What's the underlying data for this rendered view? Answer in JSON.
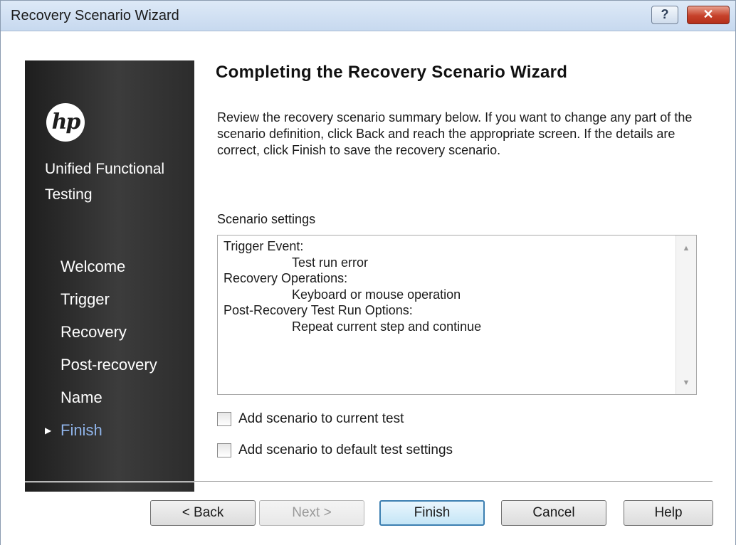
{
  "window": {
    "title": "Recovery Scenario Wizard",
    "help_button": "?",
    "close_button": "✕"
  },
  "sidebar": {
    "logo_text": "hp",
    "product_name": "Unified Functional Testing",
    "steps": [
      {
        "label": "Welcome",
        "active": false
      },
      {
        "label": "Trigger",
        "active": false
      },
      {
        "label": "Recovery",
        "active": false
      },
      {
        "label": "Post-recovery",
        "active": false
      },
      {
        "label": "Name",
        "active": false
      },
      {
        "label": "Finish",
        "active": true
      }
    ],
    "active_arrow": "▶"
  },
  "main": {
    "heading": "Completing the Recovery Scenario Wizard",
    "description": "Review the recovery scenario summary below. If you want to change any part of the scenario definition, click Back and reach the appropriate screen. If the details are correct, click Finish to save the recovery scenario.",
    "settings_label": "Scenario settings",
    "summary": {
      "trigger_title": "Trigger Event:",
      "trigger_value": "Test run error",
      "recovery_title": "Recovery Operations:",
      "recovery_value": "Keyboard or mouse operation",
      "post_title": "Post-Recovery Test Run Options:",
      "post_value": "Repeat current step and continue"
    },
    "checkbox_current_test": {
      "label": "Add scenario to current test",
      "checked": false
    },
    "checkbox_default_settings": {
      "label": "Add scenario to default test settings",
      "checked": false
    }
  },
  "buttons": {
    "back": "< Back",
    "next": "Next >",
    "finish": "Finish",
    "cancel": "Cancel",
    "help": "Help"
  },
  "colors": {
    "active_step": "#8fb3e8",
    "default_button_border": "#3c7fb1",
    "close_button": "#c6412a"
  }
}
